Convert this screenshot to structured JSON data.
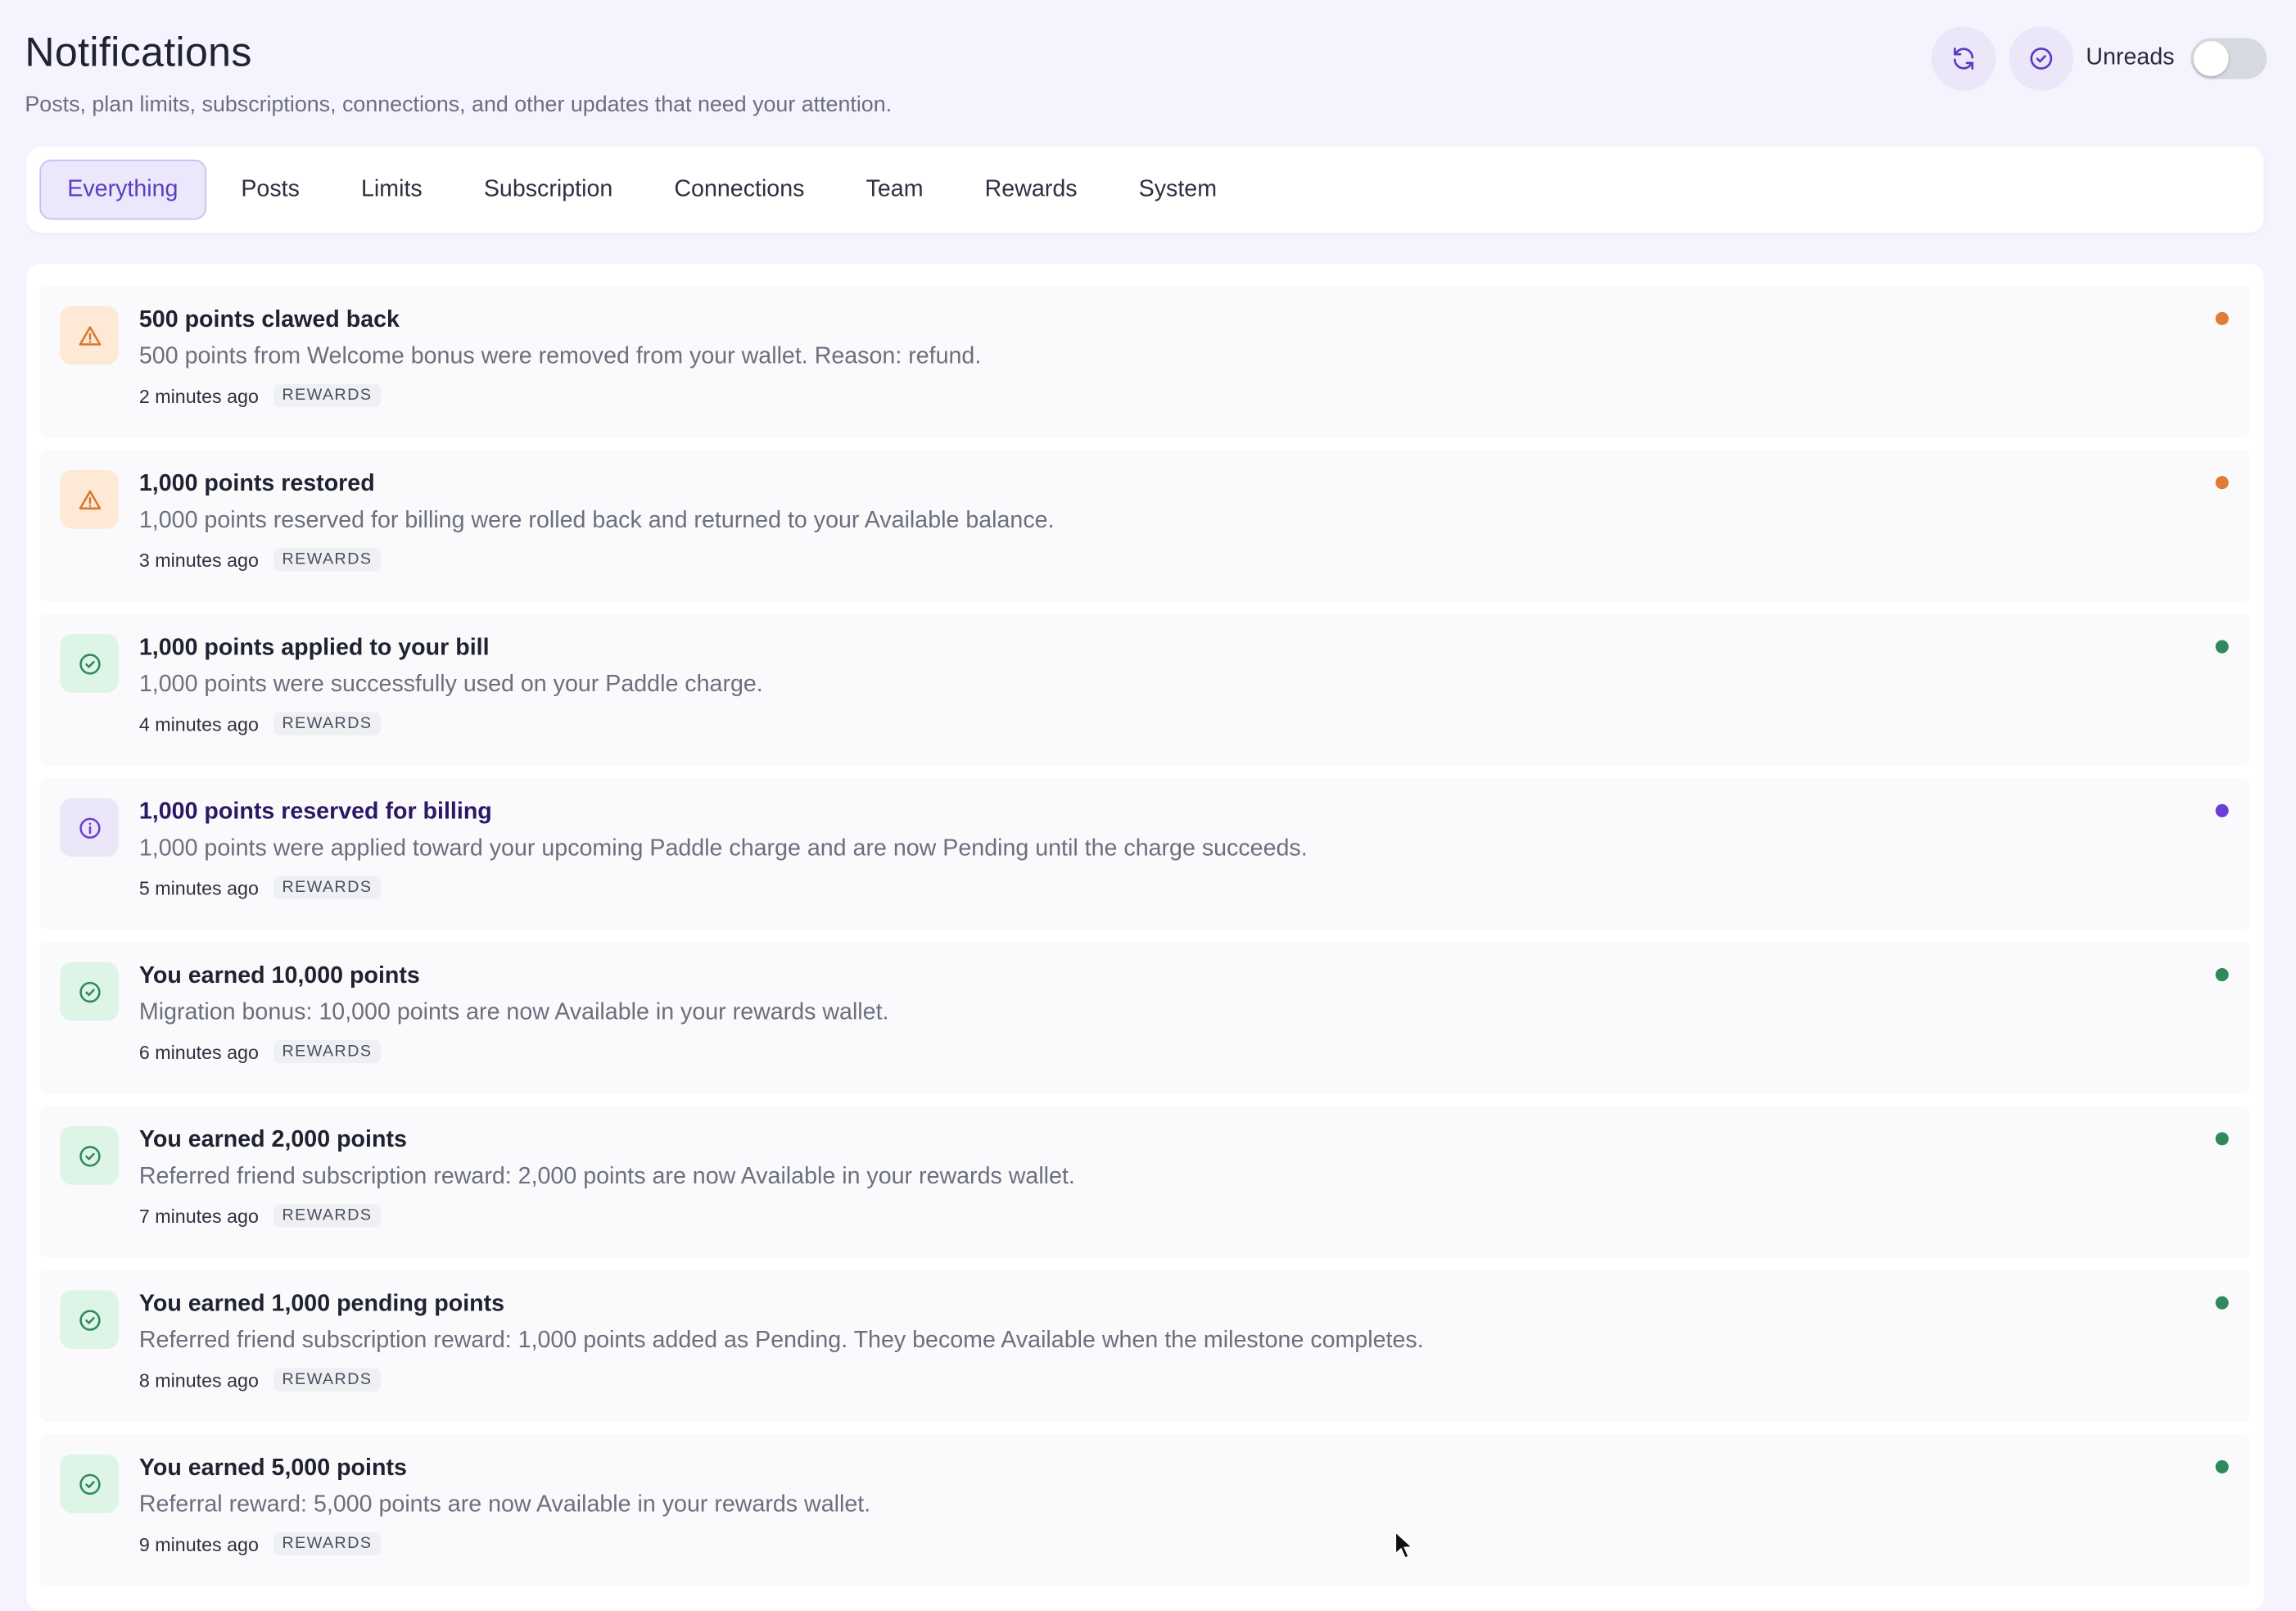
{
  "header": {
    "title": "Notifications",
    "subtitle": "Posts, plan limits, subscriptions, connections, and other updates that need your attention.",
    "refresh_icon": "refresh-icon",
    "mark_read_icon": "check-circle-icon",
    "unreads_label": "Unreads",
    "unreads_toggle_on": false
  },
  "tabs": [
    {
      "label": "Everything",
      "active": true
    },
    {
      "label": "Posts",
      "active": false
    },
    {
      "label": "Limits",
      "active": false
    },
    {
      "label": "Subscription",
      "active": false
    },
    {
      "label": "Connections",
      "active": false
    },
    {
      "label": "Team",
      "active": false
    },
    {
      "label": "Rewards",
      "active": false
    },
    {
      "label": "System",
      "active": false
    }
  ],
  "colors": {
    "accent": "#5b3cc4",
    "warning": "#e07b39",
    "success": "#2f8a5b",
    "info": "#6b3fd6"
  },
  "notifications": [
    {
      "kind": "warning",
      "icon": "warning-triangle-icon",
      "title": "500 points clawed back",
      "body": "500 points from Welcome bonus were removed from your wallet. Reason: refund.",
      "time": "2 minutes ago",
      "tag": "REWARDS"
    },
    {
      "kind": "warning",
      "icon": "warning-triangle-icon",
      "title": "1,000 points restored",
      "body": "1,000 points reserved for billing were rolled back and returned to your Available balance.",
      "time": "3 minutes ago",
      "tag": "REWARDS"
    },
    {
      "kind": "success",
      "icon": "check-circle-icon",
      "title": "1,000 points applied to your bill",
      "body": "1,000 points were successfully used on your Paddle charge.",
      "time": "4 minutes ago",
      "tag": "REWARDS"
    },
    {
      "kind": "info",
      "icon": "info-circle-icon",
      "title": "1,000 points reserved for billing",
      "body": "1,000 points were applied toward your upcoming Paddle charge and are now Pending until the charge succeeds.",
      "time": "5 minutes ago",
      "tag": "REWARDS"
    },
    {
      "kind": "success",
      "icon": "check-circle-icon",
      "title": "You earned 10,000 points",
      "body": "Migration bonus: 10,000 points are now Available in your rewards wallet.",
      "time": "6 minutes ago",
      "tag": "REWARDS"
    },
    {
      "kind": "success",
      "icon": "check-circle-icon",
      "title": "You earned 2,000 points",
      "body": "Referred friend subscription reward: 2,000 points are now Available in your rewards wallet.",
      "time": "7 minutes ago",
      "tag": "REWARDS"
    },
    {
      "kind": "success",
      "icon": "check-circle-icon",
      "title": "You earned 1,000 pending points",
      "body": "Referred friend subscription reward: 1,000 points added as Pending. They become Available when the milestone completes.",
      "time": "8 minutes ago",
      "tag": "REWARDS"
    },
    {
      "kind": "success",
      "icon": "check-circle-icon",
      "title": "You earned 5,000 points",
      "body": "Referral reward: 5,000 points are now Available in your rewards wallet.",
      "time": "9 minutes ago",
      "tag": "REWARDS"
    }
  ]
}
